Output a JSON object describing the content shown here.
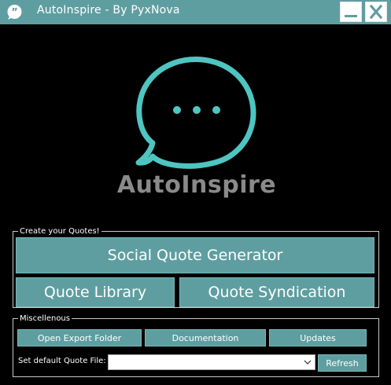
{
  "window": {
    "title": "AutoInspire - By PyxNova",
    "icon": "speech-quote-icon",
    "minimize_icon": "minimize-icon",
    "close_icon": "close-icon"
  },
  "colors": {
    "accent": "#5f9ea0",
    "logo_stroke": "#4ec5c1",
    "background": "#000000",
    "brand_text": "#8a8a8a"
  },
  "logo": {
    "icon": "chat-bubble-icon",
    "brand": "AutoInspire"
  },
  "create_group": {
    "legend": "Create your Quotes!",
    "social_label": "Social Quote Generator",
    "library_label": "Quote Library",
    "syndication_label": "Quote Syndication"
  },
  "misc_group": {
    "legend": "Miscellenous",
    "export_label": "Open Export Folder",
    "docs_label": "Documentation",
    "updates_label": "Updates",
    "default_file_label": "Set default Quote File:",
    "default_file_value": "",
    "refresh_label": "Refresh"
  }
}
